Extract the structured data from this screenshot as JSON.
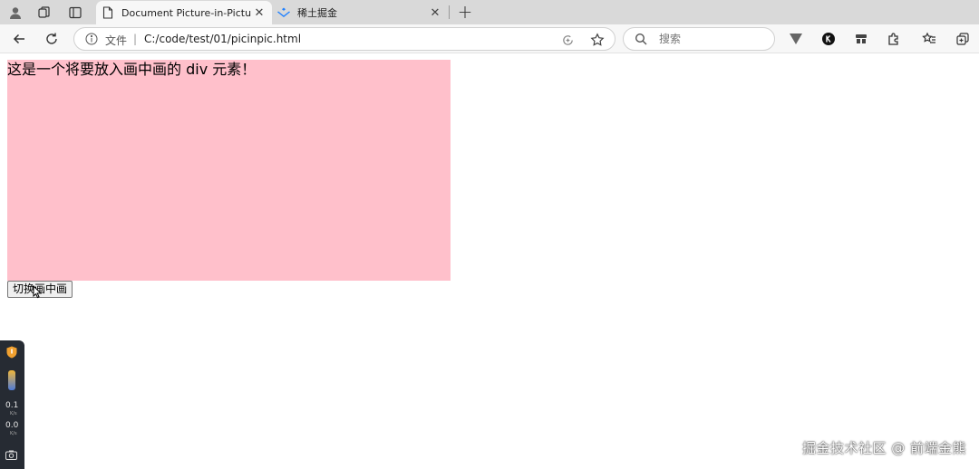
{
  "tabs": [
    {
      "title": "Document Picture-in-Picture API"
    },
    {
      "title": "稀土掘金"
    }
  ],
  "address_bar": {
    "security_label": "文件",
    "url": "C:/code/test/01/picinpic.html"
  },
  "search": {
    "placeholder": "搜索"
  },
  "page": {
    "pip_text": "这是一个将要放入画中画的 div 元素！",
    "toggle_button_label": "切换画中画"
  },
  "side_widget": {
    "upload_speed": "0.1",
    "upload_unit": "K/s",
    "download_speed": "0.0",
    "download_unit": "K/s"
  },
  "watermark": "掘金技术社区 @ 前端金熊",
  "colors": {
    "pip_background": "#ffc0cb",
    "tabstrip": "#d9d9d9",
    "toolbar": "#f7f7f7"
  }
}
